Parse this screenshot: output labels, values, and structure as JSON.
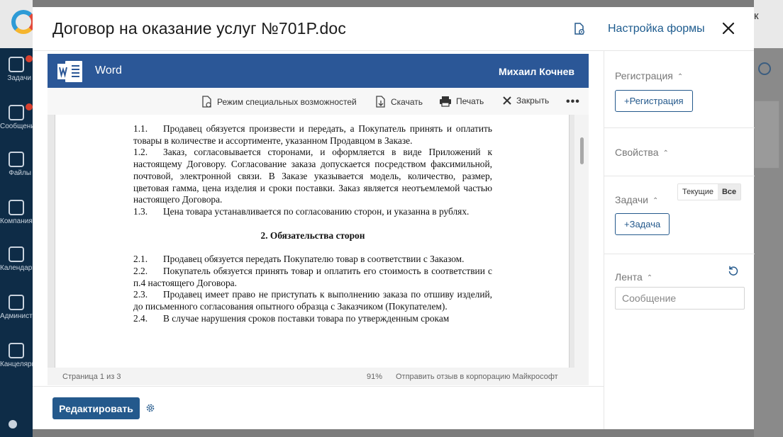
{
  "background": {
    "topbar_letter": "к",
    "nav": [
      {
        "label": "Задачи"
      },
      {
        "label": "Сообщения"
      },
      {
        "label": "Файлы"
      },
      {
        "label": "Компания"
      },
      {
        "label": "Календарь"
      },
      {
        "label": "Администрирование"
      },
      {
        "label": "Канцелярия"
      }
    ]
  },
  "modal": {
    "title": "Договор на оказание услуг №701P.doc",
    "form_settings_label": "Настройка формы",
    "close_icon": "close-icon",
    "doc_icon": "document-settings-icon"
  },
  "viewer": {
    "app_name": "Word",
    "user_name": "Михаил Кочнев",
    "toolbar": {
      "accessibility": "Режим специальных возможностей",
      "download": "Скачать",
      "print": "Печать",
      "close": "Закрыть",
      "more": "•••"
    },
    "document": {
      "clauses_top": [
        {
          "num": "1.1.",
          "text": "Продавец обязуется произвести и передать, а Покупатель принять и оплатить товары в количестве и ассортименте, указанном Продавцом в Заказе."
        },
        {
          "num": "1.2.",
          "text": "Заказ, согласовывается сторонами, и оформляется в виде Приложений к настоящему Договору. Согласование заказа допускается посредством факсимильной, почтовой, электронной связи. В Заказе указывается модель, количество, размер, цветовая гамма, цена изделия и сроки поставки. Заказ является неотъемлемой частью настоящего Договора."
        },
        {
          "num": "1.3.",
          "text": "Цена товара устанавливается по согласованию сторон, и указанна в рублях."
        }
      ],
      "section_heading": "2.   Обязательства сторон",
      "clauses_bottom": [
        {
          "num": "2.1.",
          "text": "Продавец обязуется передать Покупателю товар в соответствии с Заказом."
        },
        {
          "num": "2.2.",
          "text": "Покупатель обязуется принять товар и оплатить его стоимость в соответствии с п.4 настоящего Договора."
        },
        {
          "num": "2.3.",
          "text": "Продавец имеет право не приступать к выполнению заказа по отшиву изделий, до письменного согласования опытного образца с Заказчиком (Покупателем)."
        },
        {
          "num": "2.4.",
          "text": "В случае нарушения сроков поставки товара по утвержденным срокам"
        }
      ]
    },
    "status": {
      "page": "Страница 1 из 3",
      "zoom": "91%",
      "feedback": "Отправить отзыв в корпорацию Майкрософт"
    }
  },
  "footer": {
    "edit_label": "Редактировать"
  },
  "right_panel": {
    "registration": {
      "title": "Регистрация",
      "button": "+Регистрация"
    },
    "properties": {
      "title": "Свойства"
    },
    "tasks": {
      "title": "Задачи",
      "filter_current": "Текущие",
      "filter_all": "Все",
      "button": "+Задача"
    },
    "feed": {
      "title": "Лента",
      "placeholder": "Сообщение"
    }
  },
  "colors": {
    "accent": "#24598c",
    "word_blue": "#2b5797"
  }
}
